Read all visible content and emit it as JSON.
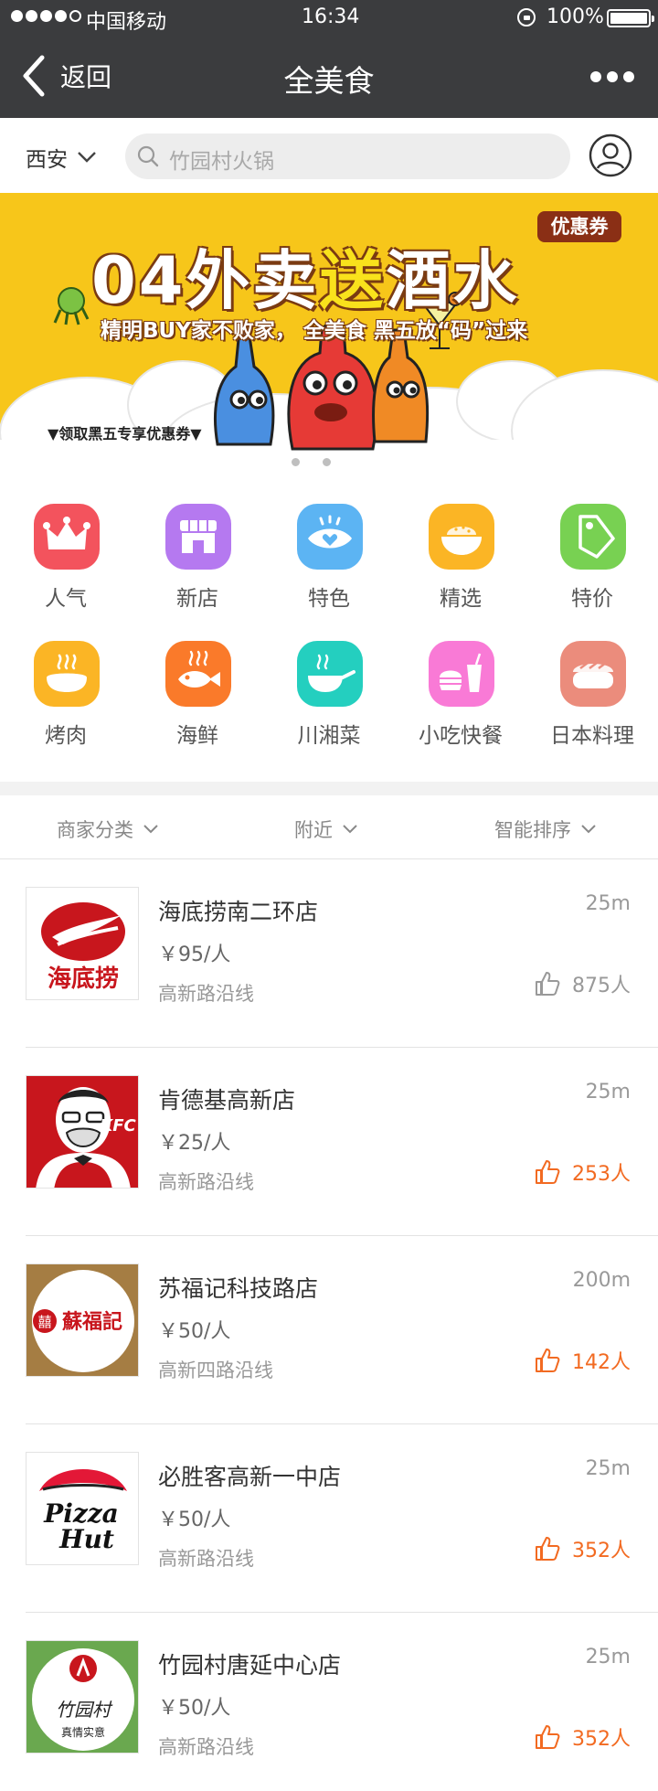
{
  "status_bar": {
    "carrier": "中国移动",
    "time": "16:34",
    "battery": "100%"
  },
  "nav": {
    "back_label": "返回",
    "title": "全美食"
  },
  "search": {
    "city": "西安",
    "placeholder": "竹园村火锅"
  },
  "banner": {
    "title_a": "04外卖",
    "title_b": "送",
    "title_c": "酒水",
    "coupon": "优惠券",
    "subtitle": "精明BUY家不败家，  全美食 黑五放“码”过来",
    "link": "▼领取黑五专享优惠券▼"
  },
  "categories": [
    {
      "label": "人气",
      "icon": "crown-icon",
      "color": "#f3535d"
    },
    {
      "label": "新店",
      "icon": "store-icon",
      "color": "#b579f0"
    },
    {
      "label": "特色",
      "icon": "eye-heart-icon",
      "color": "#5cb4f3"
    },
    {
      "label": "精选",
      "icon": "rice-bowl-icon",
      "color": "#fbb525"
    },
    {
      "label": "特价",
      "icon": "price-tag-icon",
      "color": "#78d152"
    },
    {
      "label": "烤肉",
      "icon": "bbq-icon",
      "color": "#fbb525"
    },
    {
      "label": "海鲜",
      "icon": "fish-icon",
      "color": "#fa7a2a"
    },
    {
      "label": "川湘菜",
      "icon": "wok-icon",
      "color": "#24cfbf"
    },
    {
      "label": "小吃快餐",
      "icon": "fast-food-icon",
      "color": "#f97ad6"
    },
    {
      "label": "日本料理",
      "icon": "sushi-icon",
      "color": "#eb8c7c"
    }
  ],
  "filters": {
    "category": "商家分类",
    "nearby": "附近",
    "sort": "智能排序"
  },
  "restaurants": [
    {
      "name": "海底捞南二环店",
      "price": "￥95/人",
      "area": "高新路沿线",
      "distance": "25m",
      "likes": "875人",
      "liked": false,
      "logo": "haidilao-logo"
    },
    {
      "name": "肯德基高新店",
      "price": "￥25/人",
      "area": "高新路沿线",
      "distance": "25m",
      "likes": "253人",
      "liked": true,
      "logo": "kfc-logo"
    },
    {
      "name": "苏福记科技路店",
      "price": "￥50/人",
      "area": "高新四路沿线",
      "distance": "200m",
      "likes": "142人",
      "liked": true,
      "logo": "sufuji-logo"
    },
    {
      "name": "必胜客高新一中店",
      "price": "￥50/人",
      "area": "高新路沿线",
      "distance": "25m",
      "likes": "352人",
      "liked": true,
      "logo": "pizzahut-logo"
    },
    {
      "name": "竹园村唐延中心店",
      "price": "￥50/人",
      "area": "高新路沿线",
      "distance": "25m",
      "likes": "352人",
      "liked": true,
      "logo": "zhuyuancun-logo"
    }
  ],
  "logo_text": {
    "haidilao": "海底捞",
    "kfc": "KFC",
    "sufuji": "蘇福記",
    "sufuji_seal": "囍",
    "pizzahut_a": "Pizza",
    "pizzahut_b": "Hut",
    "zhuyuancun": "竹园村",
    "zhuyuancun_sub": "真情实意"
  }
}
